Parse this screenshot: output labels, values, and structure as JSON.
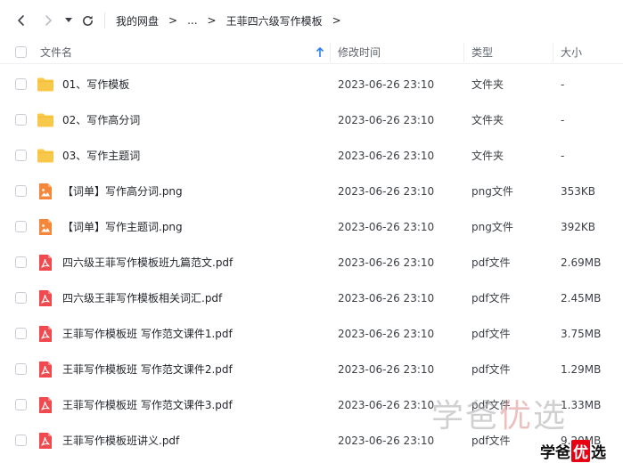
{
  "breadcrumb": {
    "root": "我的网盘",
    "ellipsis": "...",
    "current": "王菲四六级写作模板",
    "separator": ">"
  },
  "columns": {
    "name": "文件名",
    "modified": "修改时间",
    "type": "类型",
    "size": "大小"
  },
  "files": [
    {
      "name": "01、写作模板",
      "modified": "2023-06-26 23:10",
      "type": "文件夹",
      "size": "-",
      "icon": "folder-icon"
    },
    {
      "name": "02、写作高分词",
      "modified": "2023-06-26 23:10",
      "type": "文件夹",
      "size": "-",
      "icon": "folder-icon"
    },
    {
      "name": "03、写作主题词",
      "modified": "2023-06-26 23:10",
      "type": "文件夹",
      "size": "-",
      "icon": "folder-icon"
    },
    {
      "name": "【词单】写作高分词.png",
      "modified": "2023-06-26 23:10",
      "type": "png文件",
      "size": "353KB",
      "icon": "image-file-icon"
    },
    {
      "name": "【词单】写作主题词.png",
      "modified": "2023-06-26 23:10",
      "type": "png文件",
      "size": "392KB",
      "icon": "image-file-icon"
    },
    {
      "name": "四六级王菲写作模板班九篇范文.pdf",
      "modified": "2023-06-26 23:10",
      "type": "pdf文件",
      "size": "2.69MB",
      "icon": "pdf-file-icon"
    },
    {
      "name": "四六级王菲写作模板相关词汇.pdf",
      "modified": "2023-06-26 23:10",
      "type": "pdf文件",
      "size": "2.45MB",
      "icon": "pdf-file-icon"
    },
    {
      "name": "王菲写作模板班 写作范文课件1.pdf",
      "modified": "2023-06-26 23:10",
      "type": "pdf文件",
      "size": "3.75MB",
      "icon": "pdf-file-icon"
    },
    {
      "name": "王菲写作模板班 写作范文课件2.pdf",
      "modified": "2023-06-26 23:10",
      "type": "pdf文件",
      "size": "1.29MB",
      "icon": "pdf-file-icon"
    },
    {
      "name": "王菲写作模板班 写作范文课件3.pdf",
      "modified": "2023-06-26 23:10",
      "type": "pdf文件",
      "size": "1.33MB",
      "icon": "pdf-file-icon"
    },
    {
      "name": "王菲写作模板班讲义.pdf",
      "modified": "2023-06-26 23:10",
      "type": "pdf文件",
      "size": "9.20MB",
      "icon": "pdf-file-icon"
    }
  ],
  "watermark": {
    "part1": "学",
    "part2": "爸",
    "part3": "优",
    "part4": "选"
  },
  "logo": {
    "part1": "学爸",
    "part2": "优",
    "part3": "选"
  },
  "colors": {
    "folder": "#f8c84a",
    "image_file": "#f5873b",
    "pdf_file": "#f0494e",
    "accent": "#2e7cf6"
  }
}
